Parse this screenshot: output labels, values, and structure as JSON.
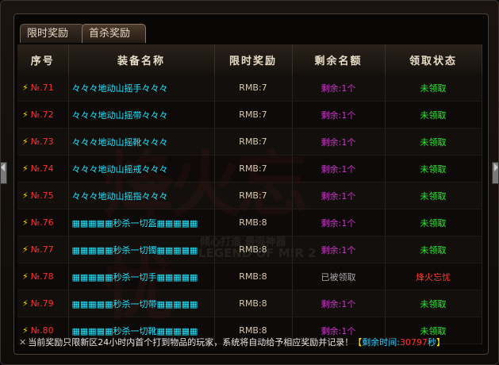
{
  "tabs": [
    "限时奖励",
    "首杀奖励"
  ],
  "columns": [
    "序号",
    "装备名称",
    "限时奖励",
    "剩余名额",
    "领取状态"
  ],
  "colors": {
    "name_cyan": "#22e6ff",
    "remain": "#c838c8",
    "status_green": "#2ee82e",
    "status_red": "#ff3a2a"
  },
  "rows": [
    {
      "no": "№.71",
      "name": "々々々地动山摇手々々々",
      "name_color": "#22e6ff",
      "reward": "RMB:7",
      "remain": "剩余:1个",
      "remain_gray": false,
      "status": "未领取",
      "status_red": false
    },
    {
      "no": "№.72",
      "name": "々々々地动山摇带々々々",
      "name_color": "#22e6ff",
      "reward": "RMB:7",
      "remain": "剩余:1个",
      "remain_gray": false,
      "status": "未领取",
      "status_red": false
    },
    {
      "no": "№.73",
      "name": "々々々地动山摇靴々々々",
      "name_color": "#22e6ff",
      "reward": "RMB:7",
      "remain": "剩余:1个",
      "remain_gray": false,
      "status": "未领取",
      "status_red": false
    },
    {
      "no": "№.74",
      "name": "々々々地动山摇戒々々々",
      "name_color": "#22e6ff",
      "reward": "RMB:7",
      "remain": "剩余:1个",
      "remain_gray": false,
      "status": "未领取",
      "status_red": false
    },
    {
      "no": "№.75",
      "name": "々々々地动山摇指々々々",
      "name_color": "#22e6ff",
      "reward": "RMB:7",
      "remain": "剩余:1个",
      "remain_gray": false,
      "status": "未领取",
      "status_red": false
    },
    {
      "no": "№.76",
      "name": "▦▦▦▦▦秒杀一切盔▦▦▦▦▦",
      "name_color": "#22e6ff",
      "reward": "RMB:8",
      "remain": "剩余:1个",
      "remain_gray": false,
      "status": "未领取",
      "status_red": false
    },
    {
      "no": "№.77",
      "name": "▦▦▦▦▦秒杀一切镯▦▦▦▦▦",
      "name_color": "#22e6ff",
      "reward": "RMB:8",
      "remain": "剩余:1个",
      "remain_gray": false,
      "status": "未领取",
      "status_red": false
    },
    {
      "no": "№.78",
      "name": "▦▦▦▦▦秒杀一切手▦▦▦▦▦",
      "name_color": "#22e6ff",
      "reward": "RMB:8",
      "remain": "已被领取",
      "remain_gray": true,
      "status": "烽火忘忧",
      "status_red": true
    },
    {
      "no": "№.79",
      "name": "▦▦▦▦▦秒杀一切带▦▦▦▦▦",
      "name_color": "#22e6ff",
      "reward": "RMB:8",
      "remain": "剩余:1个",
      "remain_gray": false,
      "status": "未领取",
      "status_red": false
    },
    {
      "no": "№.80",
      "name": "▦▦▦▦▦秒杀一切靴▦▦▦▦▦",
      "name_color": "#22e6ff",
      "reward": "RMB:8",
      "remain": "剩余:1个",
      "remain_gray": false,
      "status": "未领取",
      "status_red": false
    }
  ],
  "watermark": {
    "main": "烽火忘忧",
    "sub": "倾心打造 最强神器",
    "en": "LEGEND OF MIR 2"
  },
  "footer": {
    "notice": "当前奖励只限新区24小时内首个打到物品的玩家，系统将自动给予相应奖励并记录！",
    "bracket_open": "【",
    "time_label": "剩余时间:",
    "time_value": "30797",
    "time_unit": "秒",
    "bracket_close": "】"
  }
}
